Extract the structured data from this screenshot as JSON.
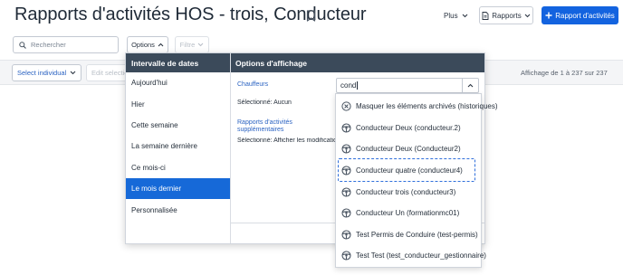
{
  "header": {
    "title": "Rapports d'activités HOS - trois, Conducteur",
    "plus_label": "Plus",
    "reports_label": "Rapports",
    "primary_label": "Rapport d'activités"
  },
  "toolbar": {
    "search_placeholder": "Rechercher",
    "options_label": "Options",
    "filter_label": "Filtre"
  },
  "subbar": {
    "select_individual_label": "Select individual",
    "edit_selection_label": "Edit selection",
    "pagination_text": "Affichage de 1 à 237 sur 237"
  },
  "options_panel": {
    "date_header": "Intervalle de dates",
    "display_header": "Options d'affichage",
    "date_items": [
      {
        "label": "Aujourd'hui"
      },
      {
        "label": "Hier"
      },
      {
        "label": "Cette semaine"
      },
      {
        "label": "La semaine dernière"
      },
      {
        "label": "Ce mois-ci"
      },
      {
        "label": "Le mois dernier"
      },
      {
        "label": "Personnalisée"
      }
    ],
    "selected_date": "Le mois dernier",
    "drivers_label": "Chauffeurs",
    "drivers_selected": "Sélectionné: Aucun",
    "additional_reports_label": "Rapports d'activités supplémentaires",
    "additional_reports_selected": "Sélectionné: Afficher les modifications"
  },
  "driver_search": {
    "value": "cond",
    "options": [
      {
        "label": "Masquer les éléments archivés (historiques)",
        "icon": "close-circle-icon"
      },
      {
        "label": "Conducteur Deux (conducteur.2)",
        "icon": "steering-wheel-icon"
      },
      {
        "label": "Conducteur Deux (Conducteur2)",
        "icon": "steering-wheel-icon"
      },
      {
        "label": "Conducteur quatre (conducteur4)",
        "icon": "steering-wheel-icon"
      },
      {
        "label": "Conducteur trois (conducteur3)",
        "icon": "steering-wheel-icon"
      },
      {
        "label": "Conducteur Un (formationmc01)",
        "icon": "steering-wheel-icon"
      },
      {
        "label": "Test Permis de Conduire (test-permis)",
        "icon": "steering-wheel-icon"
      },
      {
        "label": "Test Test (test_conducteur_gestionnaire)",
        "icon": "steering-wheel-icon"
      }
    ],
    "highlighted_option": "Conducteur quatre (conducteur4)"
  },
  "colors": {
    "primary": "#1363df",
    "panel_header": "#3b4a5a",
    "selected_item": "#1669d8",
    "link_label": "#2b63c2",
    "highlight_border": "#2f6fdb"
  }
}
